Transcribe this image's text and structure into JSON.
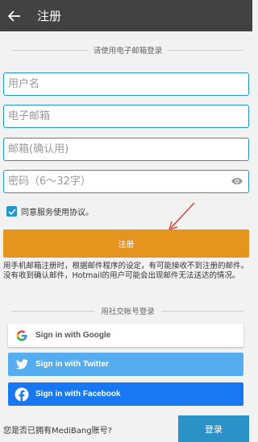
{
  "header": {
    "title": "注册"
  },
  "email_section": {
    "label": "请使用电子邮箱登录"
  },
  "form": {
    "username_placeholder": "用户名",
    "email_placeholder": "电子邮箱",
    "email_confirm_placeholder": "邮箱(确认用)",
    "password_placeholder": "密码（6〜32字）"
  },
  "agreement": {
    "label": "同意服务使用协议。",
    "checked": true
  },
  "register_button": {
    "label": "注册"
  },
  "notice": {
    "text": "用手机邮箱注册时，根据邮件程序的设定，有可能接收不到注册的邮件。没有收到确认邮件，Hotmail的用户可能会出现邮件无法送达的情况。"
  },
  "social_section": {
    "label": "用社交帐号登录"
  },
  "social_buttons": {
    "google": "Sign in with Google",
    "twitter": "Sign in with Twitter",
    "facebook": "Sign in with Facebook"
  },
  "footer": {
    "question": "您是否已拥有MediBang账号?",
    "login_label": "登录"
  },
  "colors": {
    "accent": "#2196c9",
    "register": "#e5941e",
    "appbar": "#424242",
    "twitter": "#55acee",
    "facebook": "#1877f2"
  }
}
